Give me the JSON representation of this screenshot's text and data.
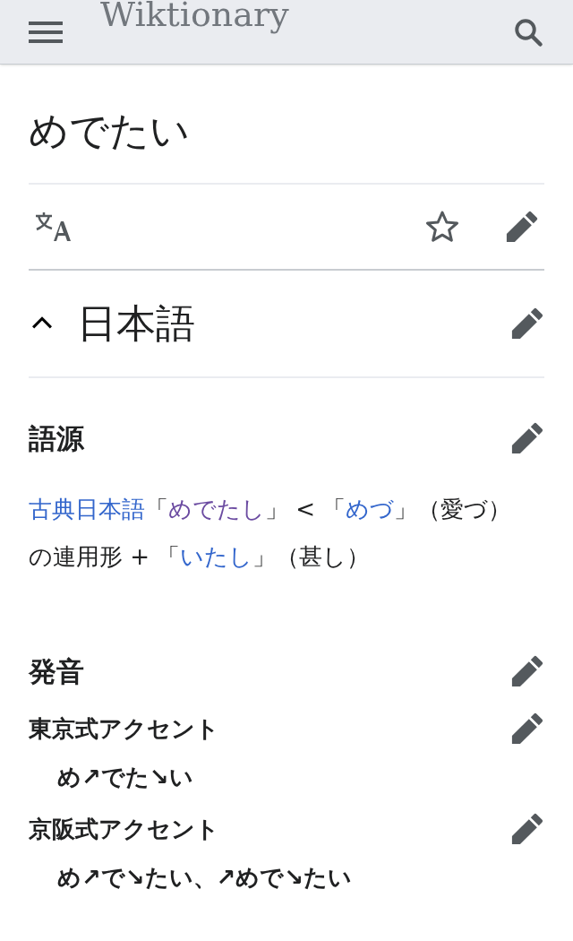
{
  "header": {
    "logo": "Wiktionary"
  },
  "page_title": "めでたい",
  "page_actions": {
    "watched": false
  },
  "section": {
    "heading": "日本語",
    "expanded": true,
    "blocks": [
      {
        "kind": "heading",
        "text": "語源"
      },
      {
        "kind": "paragraph",
        "segments": [
          {
            "kind": "link",
            "text": "古典日本語",
            "visited": false
          },
          {
            "kind": "text",
            "text": "「"
          },
          {
            "kind": "link",
            "text": "めでたし",
            "visited": true
          },
          {
            "kind": "text",
            "text": "」 < 「"
          },
          {
            "kind": "link",
            "text": "めづ",
            "visited": false
          },
          {
            "kind": "text",
            "text": "」（愛づ）の連用形 + 「"
          },
          {
            "kind": "link",
            "text": "いたし",
            "visited": false
          },
          {
            "kind": "text",
            "text": "」（甚し）"
          }
        ]
      },
      {
        "kind": "heading",
        "text": "発音"
      },
      {
        "kind": "subheading",
        "text": "東京式アクセント"
      },
      {
        "kind": "accent",
        "text": "め↗でた↘い"
      },
      {
        "kind": "subheading",
        "text": "京阪式アクセント"
      },
      {
        "kind": "accent",
        "text": "め↗で↘たい、↗めで↘たい"
      }
    ]
  }
}
